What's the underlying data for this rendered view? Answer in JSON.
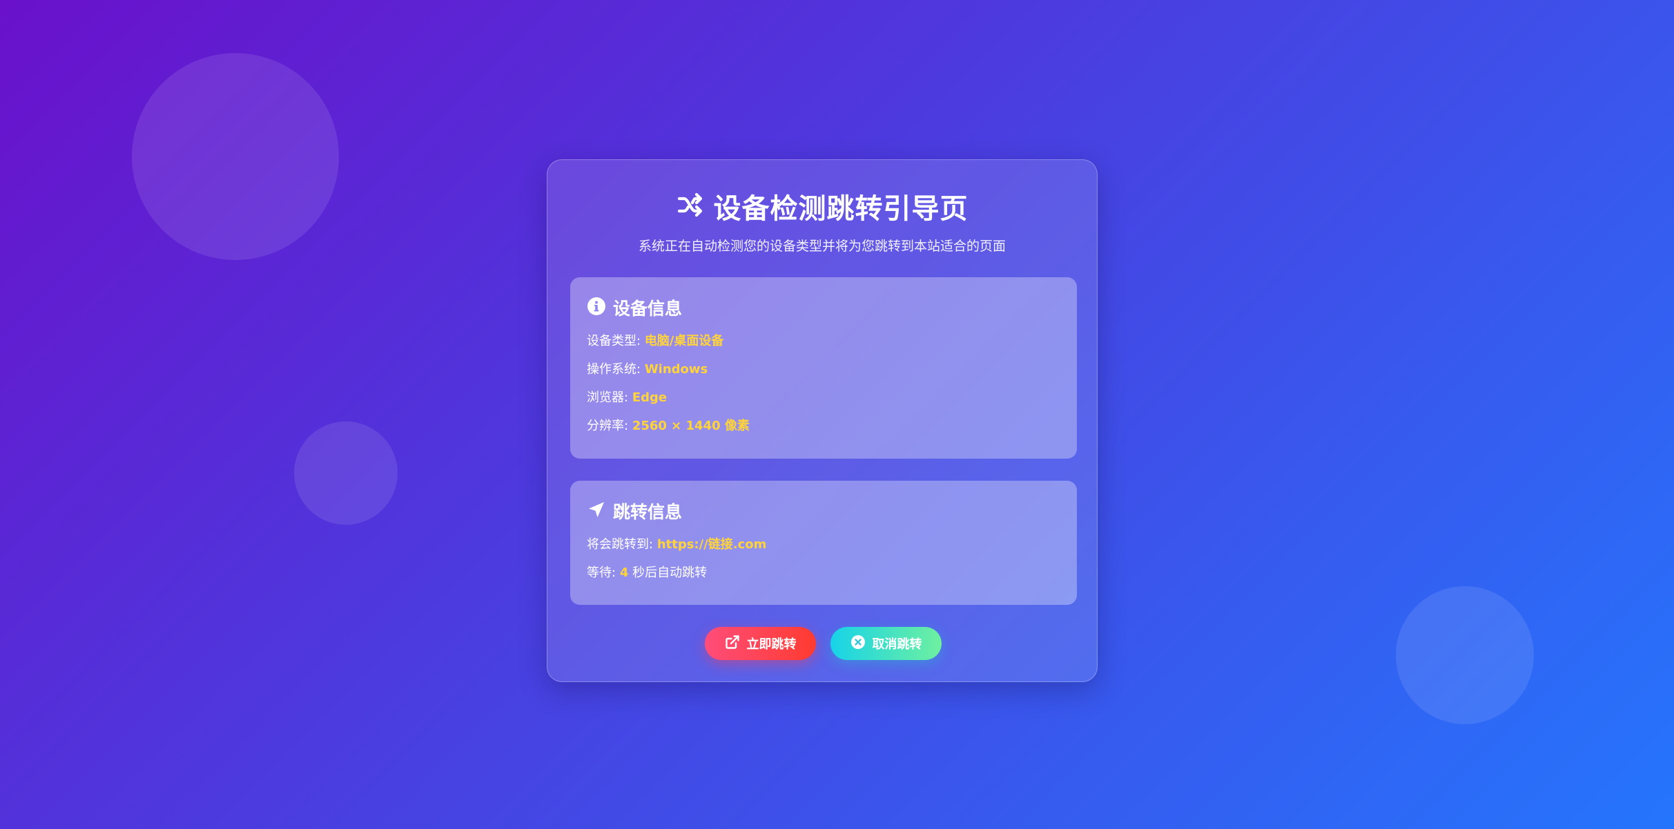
{
  "header": {
    "title": "设备检测跳转引导页",
    "subtitle": "系统正在自动检测您的设备类型并将为您跳转到本站适合的页面",
    "icon": "shuffle-icon"
  },
  "device_info": {
    "title": "设备信息",
    "icon": "info-circle-icon",
    "rows": [
      {
        "label": "设备类型:",
        "value": "电脑/桌面设备"
      },
      {
        "label": "操作系统:",
        "value": "Windows"
      },
      {
        "label": "浏览器:",
        "value": "Edge"
      },
      {
        "label": "分辨率:",
        "value": "2560 × 1440 像素"
      }
    ]
  },
  "redirect_info": {
    "title": "跳转信息",
    "icon": "paper-plane-icon",
    "target_label": "将会跳转到:",
    "target_url": "https://链接.com",
    "wait_label": "等待:",
    "wait_seconds": "4",
    "wait_suffix": "秒后自动跳转"
  },
  "buttons": {
    "go_label": "立即跳转",
    "go_icon": "external-link-icon",
    "cancel_label": "取消跳转",
    "cancel_icon": "close-circle-icon"
  },
  "colors": {
    "accent_value": "#ffd43b",
    "go_button": "#ff3b5c",
    "cancel_button": "#22d3c8"
  }
}
